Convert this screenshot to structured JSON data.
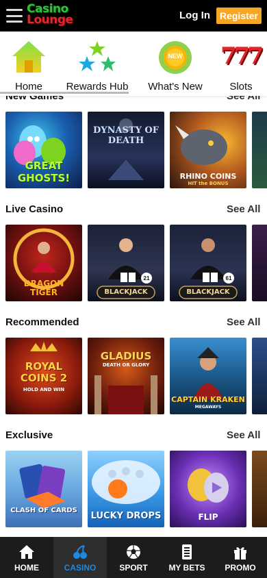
{
  "header": {
    "logo_line1": "Casino",
    "logo_line2": "Lounge",
    "login_label": "Log In",
    "register_label": "Register"
  },
  "quick_nav": [
    {
      "label": "Home",
      "icon": "house-icon"
    },
    {
      "label": "Rewards Hub",
      "icon": "stars-icon"
    },
    {
      "label": "What's New",
      "icon": "new-badge-icon"
    },
    {
      "label": "Slots",
      "icon": "slots-777-icon"
    }
  ],
  "new_badge_text": "NEW",
  "slots_icon_text": "777",
  "sections": [
    {
      "title": "New Games",
      "see_all": "See All",
      "games": [
        {
          "name": "GREAT GHOSTS!"
        },
        {
          "name": "DYNASTY OF DEATH"
        },
        {
          "name": "RHINO COINS",
          "sub": "HIT the BONUS"
        }
      ]
    },
    {
      "title": "Live Casino",
      "see_all": "See All",
      "games": [
        {
          "name": "DRAGON TIGER"
        },
        {
          "name": "BLACKJACK",
          "badge": "21"
        },
        {
          "name": "BLACKJACK",
          "badge": "61"
        }
      ]
    },
    {
      "title": "Recommended",
      "see_all": "See All",
      "games": [
        {
          "name": "ROYAL COINS 2",
          "sub": "HOLD AND WIN"
        },
        {
          "name": "GLADIUS",
          "sub": "DEATH OR GLORY"
        },
        {
          "name": "CAPTAIN KRAKEN",
          "sub": "MEGAWAYS"
        }
      ]
    },
    {
      "title": "Exclusive",
      "see_all": "See All",
      "games": [
        {
          "name": "CLASH OF CARDS"
        },
        {
          "name": "LUCKY DROPS"
        },
        {
          "name": "FLIP"
        }
      ]
    }
  ],
  "bottom_nav": [
    {
      "label": "HOME",
      "icon": "home-icon"
    },
    {
      "label": "CASINO",
      "icon": "cherries-icon",
      "active": true
    },
    {
      "label": "SPORT",
      "icon": "soccer-ball-icon"
    },
    {
      "label": "MY BETS",
      "icon": "bet-slip-icon"
    },
    {
      "label": "PROMO",
      "icon": "gift-icon"
    }
  ],
  "colors": {
    "header_bg": "#000000",
    "register_bg": "#f5a623",
    "bottom_bg": "#1c1c1c",
    "active_tab": "#1e88e5"
  }
}
